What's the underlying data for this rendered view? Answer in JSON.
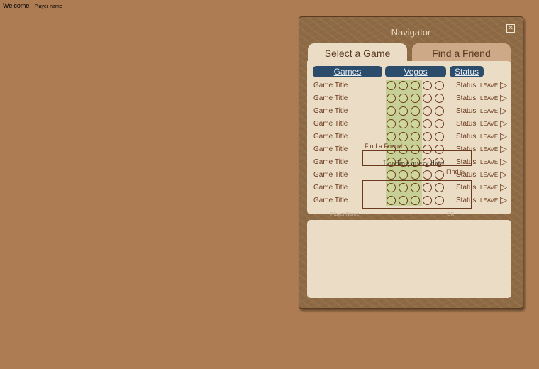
{
  "welcome": {
    "label": "Welcome:",
    "player_name": "Player name"
  },
  "navigator": {
    "title": "Navigator",
    "close_icon": "close-icon",
    "tabs": [
      {
        "label": "Select a Game",
        "active": true
      },
      {
        "label": "Find a Friend",
        "active": false
      }
    ],
    "columns": {
      "games": "Games",
      "vegos": "Vegos",
      "status": "Status"
    },
    "rows": [
      {
        "title": "Game Title",
        "vegos_filled": 3,
        "vegos_total": 5,
        "status": "Status",
        "action": "LEAVE"
      },
      {
        "title": "Game Title",
        "vegos_filled": 3,
        "vegos_total": 5,
        "status": "Status",
        "action": "LEAVE"
      },
      {
        "title": "Game Title",
        "vegos_filled": 3,
        "vegos_total": 5,
        "status": "Status",
        "action": "LEAVE"
      },
      {
        "title": "Game Title",
        "vegos_filled": 3,
        "vegos_total": 5,
        "status": "Status",
        "action": "LEAVE"
      },
      {
        "title": "Game Title",
        "vegos_filled": 3,
        "vegos_total": 5,
        "status": "Status",
        "action": "LEAVE"
      },
      {
        "title": "Game Title",
        "vegos_filled": 3,
        "vegos_total": 5,
        "status": "Status",
        "action": "LEAVE"
      },
      {
        "title": "Game Title",
        "vegos_filled": 3,
        "vegos_total": 5,
        "status": "Status",
        "action": "LEAVE"
      },
      {
        "title": "Game Title",
        "vegos_filled": 3,
        "vegos_total": 5,
        "status": "Status",
        "action": "LEAVE"
      },
      {
        "title": "Game Title",
        "vegos_filled": 3,
        "vegos_total": 5,
        "status": "Status",
        "action": "LEAVE"
      },
      {
        "title": "Game Title",
        "vegos_filled": 3,
        "vegos_total": 5,
        "status": "Status",
        "action": "LEAVE"
      }
    ],
    "overlay": {
      "find_friend_label": "Find a Friend",
      "loading_text": "Loading query data",
      "find_button": "Find"
    },
    "ghost": {
      "player_name": "Player Name",
      "ok": "OK"
    }
  }
}
